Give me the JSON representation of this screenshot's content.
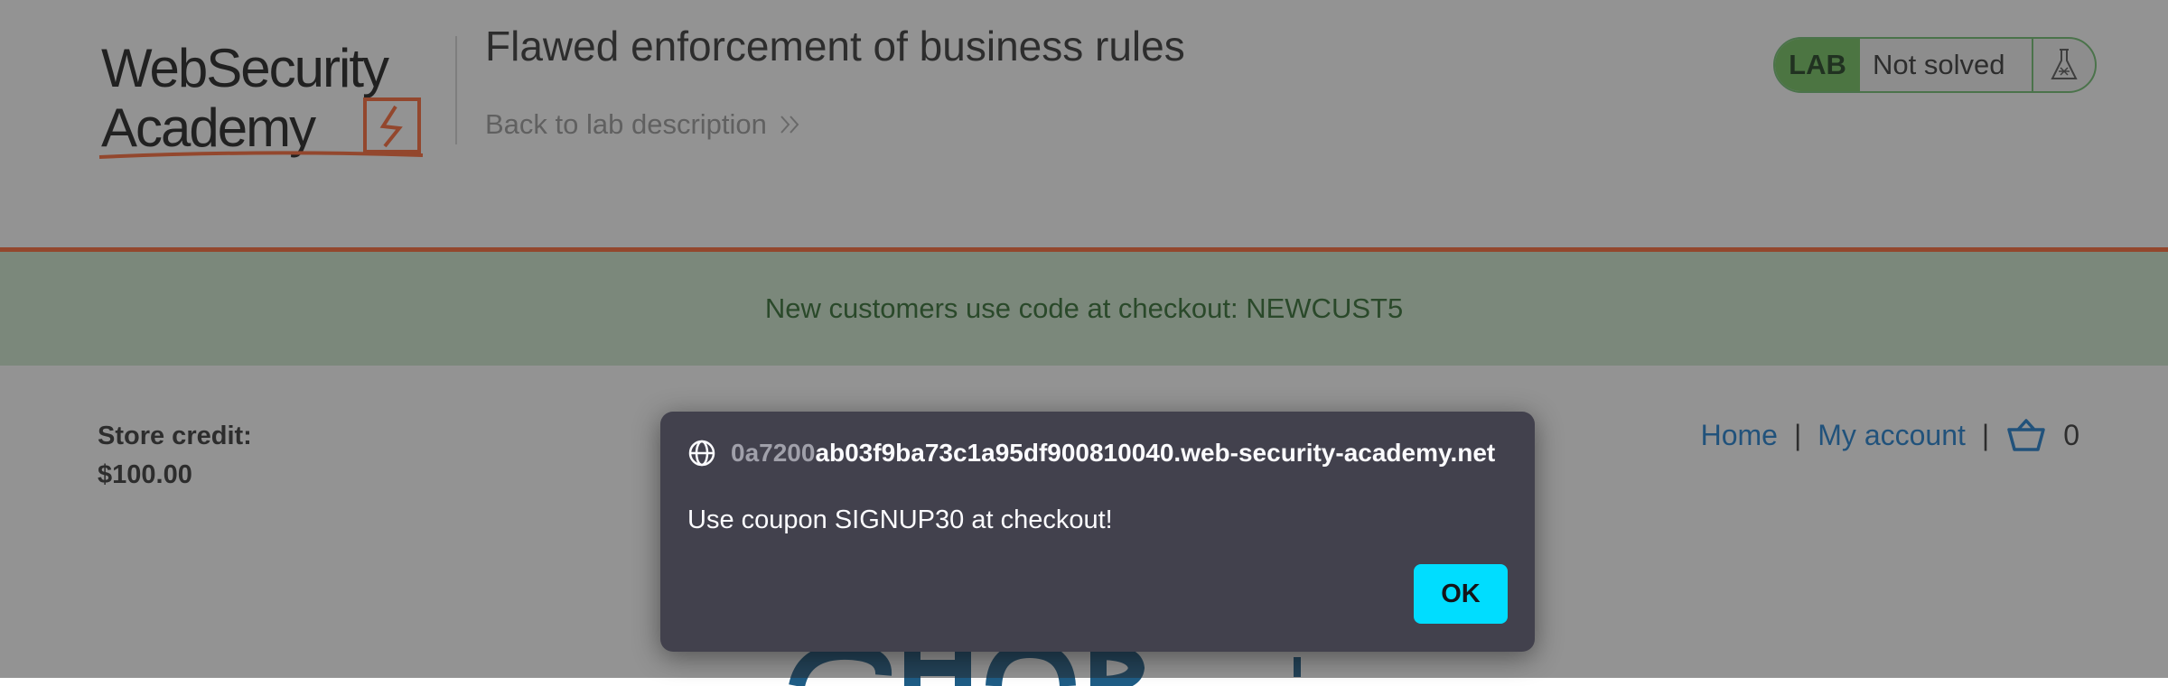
{
  "header": {
    "logo_text": "Web Security Academy",
    "lab_title": "Flawed enforcement of business rules",
    "back_link": "Back to lab description",
    "lab_badge": "LAB",
    "lab_status": "Not solved"
  },
  "notification": {
    "text": "New customers use code at checkout: NEWCUST5"
  },
  "store": {
    "credit_label": "Store credit:",
    "credit_value": "$100.00"
  },
  "nav": {
    "home": "Home",
    "separator": "|",
    "my_account": "My account",
    "cart_count": "0"
  },
  "dialog": {
    "origin_faded": "0a7200",
    "origin": "ab03f9ba73c1a95df900810040.web-security-academy.net",
    "message": "Use coupon SIGNUP30 at checkout!",
    "ok_label": "OK"
  },
  "colors": {
    "accent_orange": "#ff6633",
    "lab_green": "#70c25c",
    "link_blue": "#1a7dcf",
    "dialog_bg": "#42414d",
    "ok_button": "#00ddff"
  },
  "icons": [
    "globe-icon",
    "flask-icon",
    "cart-icon",
    "chevron-double-right-icon"
  ]
}
